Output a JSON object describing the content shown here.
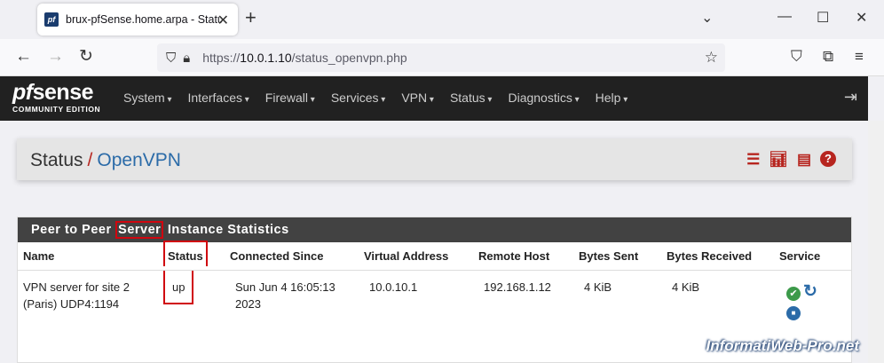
{
  "browser": {
    "tab_title": "brux-pfSense.home.arpa - Status",
    "favicon": "pf",
    "url_base": "https://",
    "url_host": "10.0.1.10",
    "url_path": "/status_openvpn.php"
  },
  "navbar": {
    "logo_main_prefix": "pf",
    "logo_main_suffix": "sense",
    "logo_sub": "COMMUNITY EDITION",
    "menu": [
      "System",
      "Interfaces",
      "Firewall",
      "Services",
      "VPN",
      "Status",
      "Diagnostics",
      "Help"
    ]
  },
  "breadcrumb": {
    "parent": "Status",
    "separator": "/",
    "current": "OpenVPN"
  },
  "panel": {
    "title_prefix": "Peer to Peer",
    "title_highlight": "Server",
    "title_suffix": "Instance Statistics",
    "columns": [
      "Name",
      "Status",
      "Connected Since",
      "Virtual Address",
      "Remote Host",
      "Bytes Sent",
      "Bytes Received",
      "Service"
    ],
    "row": {
      "name": "VPN server for site 2 (Paris) UDP4:1194",
      "status": "up",
      "connected_since": "Sun Jun 4 16:05:13 2023",
      "virtual_address": "10.0.10.1",
      "remote_host": "192.168.1.12",
      "bytes_sent": "4 KiB",
      "bytes_received": "4 KiB"
    }
  },
  "watermark": "InformatiWeb-Pro.net",
  "colors": {
    "accent_red": "#b7251f",
    "link_blue": "#2b6ba8",
    "navbar_bg": "#212121",
    "highlight_box": "#d0060f"
  }
}
